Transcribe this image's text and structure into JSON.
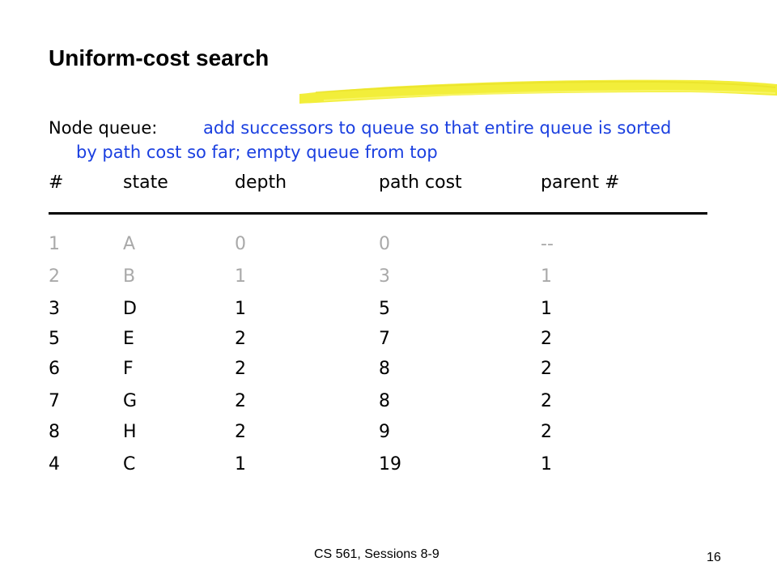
{
  "title": "Uniform-cost search",
  "queue": {
    "label": "Node queue:",
    "description_line1": "add successors to queue so that entire queue is sorted",
    "description_line2": "by path cost so far; empty queue from top"
  },
  "table": {
    "headers": [
      "#",
      "state",
      "depth",
      "path cost",
      "parent #"
    ],
    "rows": [
      {
        "num": "1",
        "state": "A",
        "depth": "0",
        "path_cost": "0",
        "parent": "--",
        "faded": true
      },
      {
        "num": "2",
        "state": "B",
        "depth": "1",
        "path_cost": "3",
        "parent": "1",
        "faded": true
      },
      {
        "num": "3",
        "state": "D",
        "depth": "1",
        "path_cost": "5",
        "parent": "1",
        "faded": false
      },
      {
        "num": "5",
        "state": "E",
        "depth": "2",
        "path_cost": "7",
        "parent": "2",
        "faded": false
      },
      {
        "num": "6",
        "state": "F",
        "depth": "2",
        "path_cost": "8",
        "parent": "2",
        "faded": false
      },
      {
        "num": "7",
        "state": "G",
        "depth": "2",
        "path_cost": "8",
        "parent": "2",
        "faded": false
      },
      {
        "num": "8",
        "state": "H",
        "depth": "2",
        "path_cost": "9",
        "parent": "2",
        "faded": false
      },
      {
        "num": "4",
        "state": "C",
        "depth": "1",
        "path_cost": "19",
        "parent": "1",
        "faded": false
      }
    ]
  },
  "footer": {
    "course": "CS 561,  Sessions 8-9",
    "page_number": "16"
  },
  "colors": {
    "description": "#1a3fe0",
    "faded_rows": "#a9a9a9",
    "highlight": "#f2ee3a"
  }
}
